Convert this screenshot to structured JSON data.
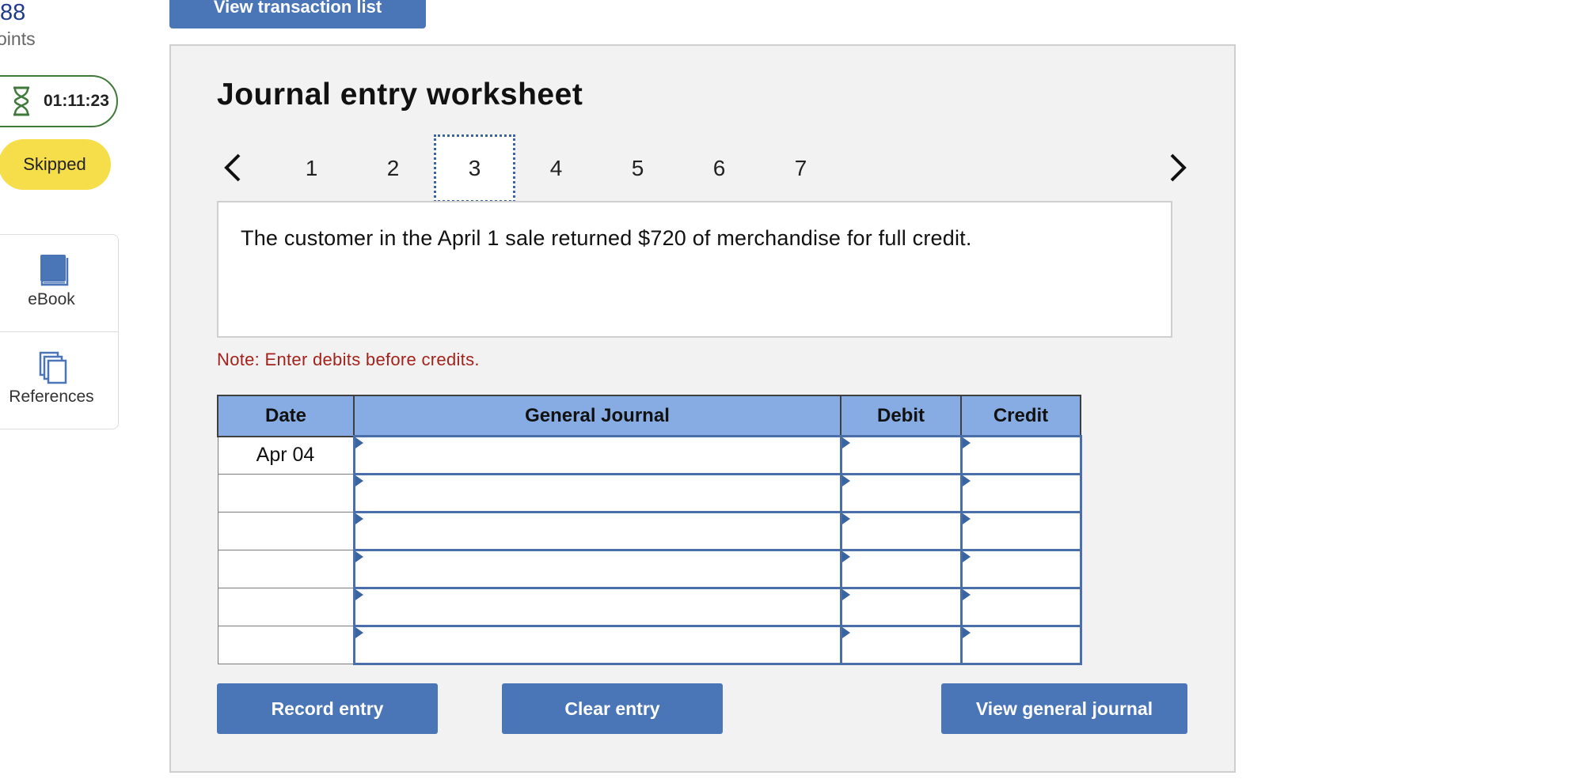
{
  "sidebar": {
    "score": ".88",
    "points_label": "oints",
    "timer": "01:11:23",
    "status_badge": "Skipped",
    "tools": [
      {
        "label": "eBook",
        "icon": "book-icon"
      },
      {
        "label": "References",
        "icon": "documents-icon"
      }
    ]
  },
  "header": {
    "view_transaction_list": "View transaction list"
  },
  "worksheet": {
    "title": "Journal entry worksheet",
    "steps": [
      "1",
      "2",
      "3",
      "4",
      "5",
      "6",
      "7"
    ],
    "active_step": "3",
    "description": "The customer in the April 1 sale returned $720 of merchandise for full credit.",
    "note": "Note: Enter debits before credits.",
    "table": {
      "columns": [
        "Date",
        "General Journal",
        "Debit",
        "Credit"
      ],
      "rows": [
        {
          "date": "Apr 04",
          "account": "",
          "debit": "",
          "credit": ""
        },
        {
          "date": "",
          "account": "",
          "debit": "",
          "credit": ""
        },
        {
          "date": "",
          "account": "",
          "debit": "",
          "credit": ""
        },
        {
          "date": "",
          "account": "",
          "debit": "",
          "credit": ""
        },
        {
          "date": "",
          "account": "",
          "debit": "",
          "credit": ""
        },
        {
          "date": "",
          "account": "",
          "debit": "",
          "credit": ""
        }
      ]
    },
    "buttons": {
      "record": "Record entry",
      "clear": "Clear entry",
      "view_journal": "View general journal"
    }
  },
  "colors": {
    "accent": "#4a76b8",
    "header_fill": "#86ace3",
    "note": "#a3221b",
    "badge": "#f6dd4a",
    "timer_border": "#3f7a3a"
  }
}
